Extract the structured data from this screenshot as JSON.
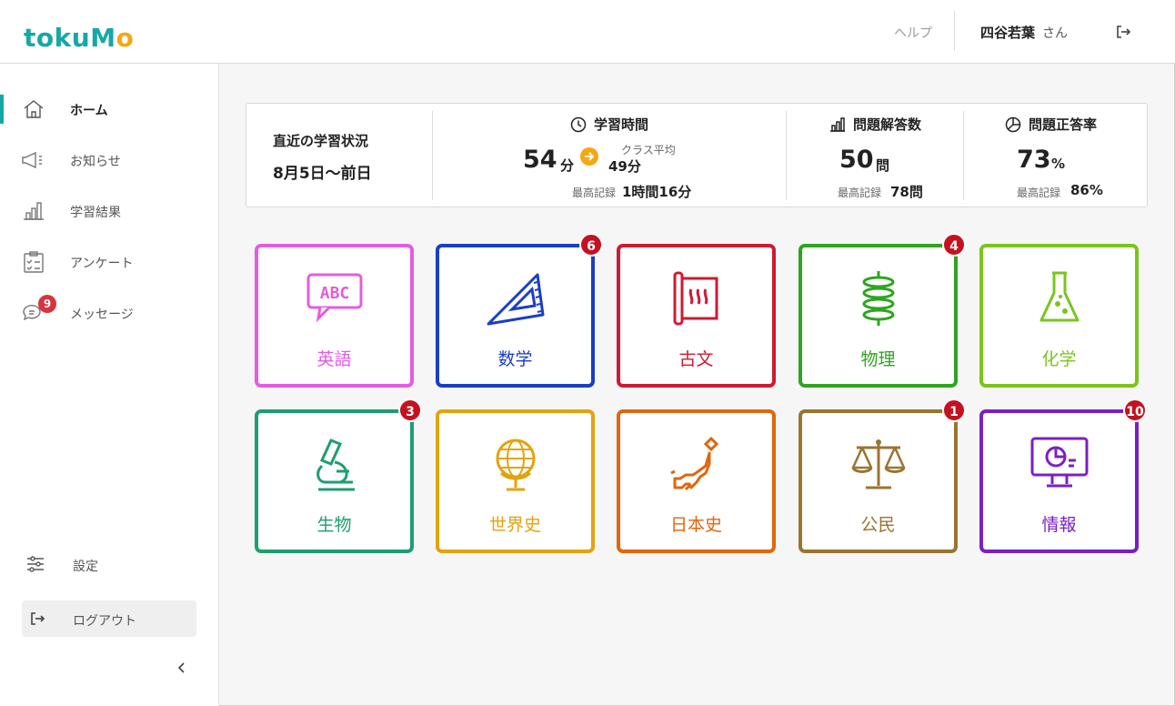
{
  "header": {
    "logo": {
      "letters": [
        "t",
        "o",
        "k",
        "u",
        "M",
        "o"
      ],
      "colors": [
        "#16a8a5",
        "#16a8a5",
        "#16a8a5",
        "#16a8a5",
        "#16a8a5",
        "#f3a814"
      ]
    },
    "help_label": "ヘルプ",
    "user_name": "四谷若葉",
    "user_suffix": "さん"
  },
  "sidebar": {
    "items": [
      {
        "label": "ホーム",
        "icon": "home-icon",
        "active": true
      },
      {
        "label": "お知らせ",
        "icon": "megaphone-icon",
        "active": false
      },
      {
        "label": "学習結果",
        "icon": "bar-chart-icon",
        "active": false
      },
      {
        "label": "アンケート",
        "icon": "clipboard-check-icon",
        "active": false
      },
      {
        "label": "メッセージ",
        "icon": "chat-icon",
        "active": false,
        "badge": "9"
      }
    ],
    "settings_label": "設定",
    "logout_label": "ログアウト"
  },
  "stats": {
    "recent_title": "直近の学習状況",
    "recent_range": "8月5日〜前日",
    "study_time": {
      "title": "学習時間",
      "value": "54",
      "unit": "分",
      "class_avg_label": "クラス平均",
      "class_avg_value": "49分",
      "best_label": "最高記録",
      "best_value": "1時間16分"
    },
    "answers": {
      "title": "問題解答数",
      "value": "50",
      "unit": "問",
      "best_label": "最高記録",
      "best_value": "78問"
    },
    "accuracy": {
      "title": "問題正答率",
      "value": "73",
      "unit": "%",
      "best_label": "最高記録",
      "best_value": "86%"
    }
  },
  "subjects": [
    {
      "label": "英語",
      "icon": "abc-speech-icon",
      "color": "#e35de0",
      "badge": ""
    },
    {
      "label": "数学",
      "icon": "set-square-icon",
      "color": "#1a3ec4",
      "badge": "6"
    },
    {
      "label": "古文",
      "icon": "scroll-icon",
      "color": "#cc1b33",
      "badge": ""
    },
    {
      "label": "物理",
      "icon": "spring-icon",
      "color": "#2ea51f",
      "badge": "4"
    },
    {
      "label": "化学",
      "icon": "flask-icon",
      "color": "#7ac51d",
      "badge": ""
    },
    {
      "label": "生物",
      "icon": "microscope-icon",
      "color": "#1e9e6f",
      "badge": "3"
    },
    {
      "label": "世界史",
      "icon": "globe-icon",
      "color": "#e3a30e",
      "badge": ""
    },
    {
      "label": "日本史",
      "icon": "japan-map-icon",
      "color": "#e0660d",
      "badge": ""
    },
    {
      "label": "公民",
      "icon": "scales-icon",
      "color": "#9b7431",
      "badge": "1"
    },
    {
      "label": "情報",
      "icon": "monitor-chart-icon",
      "color": "#7b1fc4",
      "badge": "10"
    }
  ]
}
